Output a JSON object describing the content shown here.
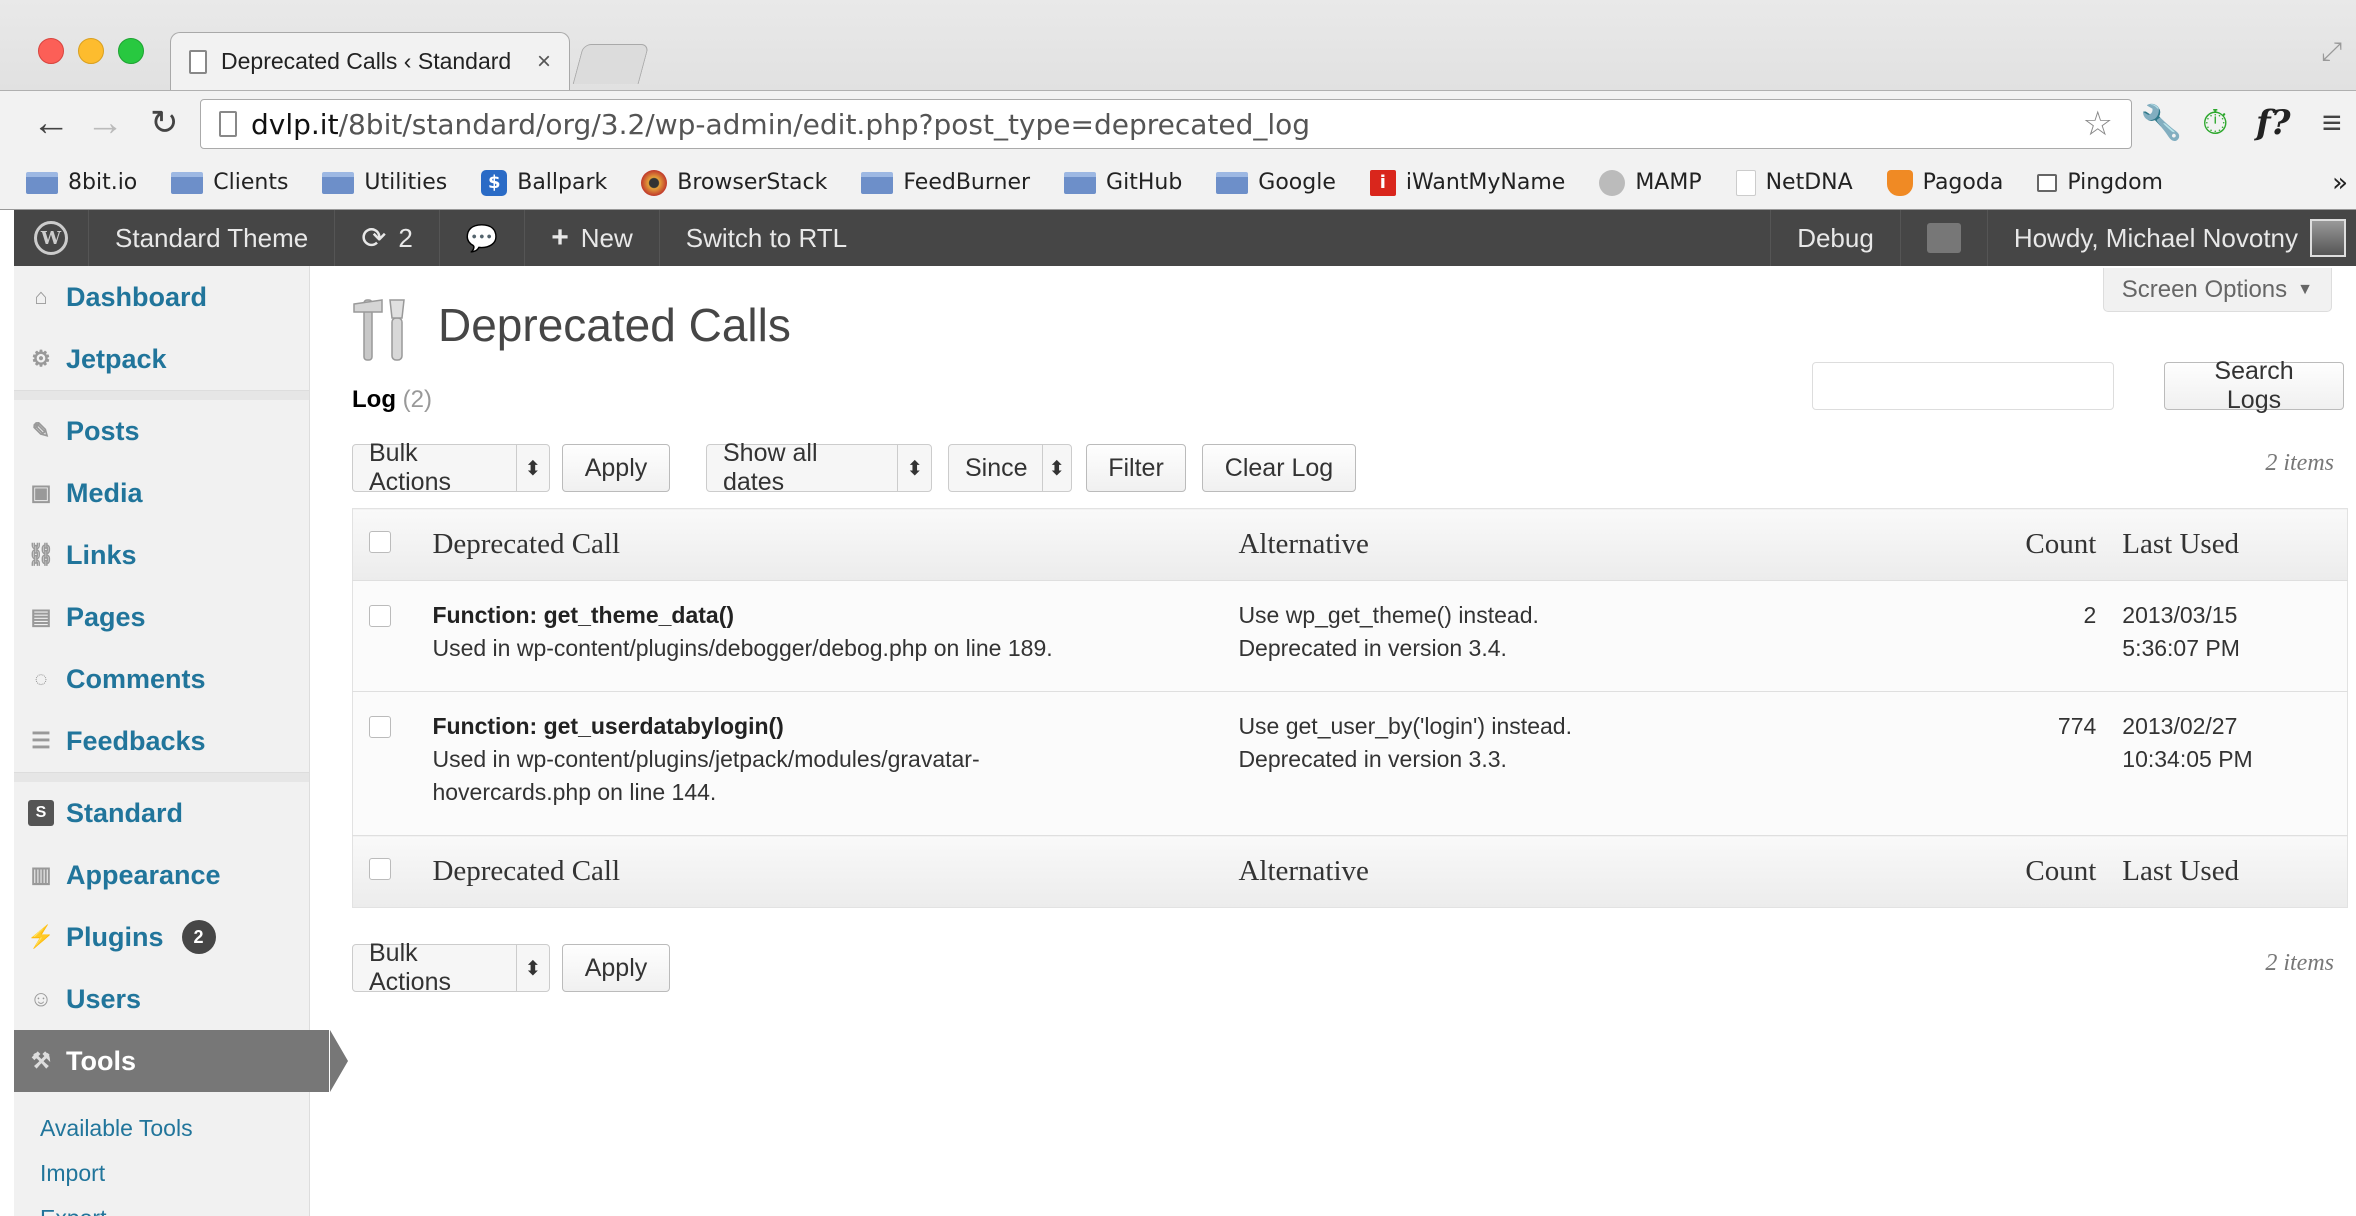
{
  "browser": {
    "tab_title": "Deprecated Calls ‹ Standard",
    "url_host": "dvlp.it",
    "url_path": "/8bit/standard/org/3.2/wp-admin/edit.php?post_type=deprecated_log",
    "bookmarks": [
      {
        "label": "8bit.io",
        "icon": "folder-icon"
      },
      {
        "label": "Clients",
        "icon": "folder-icon"
      },
      {
        "label": "Utilities",
        "icon": "folder-icon"
      },
      {
        "label": "Ballpark",
        "icon": "ballpark-icon"
      },
      {
        "label": "BrowserStack",
        "icon": "browserstack-icon"
      },
      {
        "label": "FeedBurner",
        "icon": "folder-icon"
      },
      {
        "label": "GitHub",
        "icon": "folder-icon"
      },
      {
        "label": "Google",
        "icon": "folder-icon"
      },
      {
        "label": "iWantMyName",
        "icon": "iwantmyname-icon"
      },
      {
        "label": "MAMP",
        "icon": "mamp-icon"
      },
      {
        "label": "NetDNA",
        "icon": "page-icon"
      },
      {
        "label": "Pagoda",
        "icon": "pagoda-icon"
      },
      {
        "label": "Pingdom",
        "icon": "pingdom-icon"
      }
    ],
    "bookmarks_more": "»"
  },
  "adminbar": {
    "site_name": "Standard Theme",
    "updates_count": "2",
    "new_label": "New",
    "rtl_label": "Switch to RTL",
    "debug_label": "Debug",
    "howdy": "Howdy, Michael Novotny"
  },
  "sidebar": {
    "items": [
      {
        "label": "Dashboard",
        "icon": "dashboard-icon"
      },
      {
        "label": "Jetpack",
        "icon": "jetpack-icon"
      },
      {
        "label": "Posts",
        "icon": "pin-icon"
      },
      {
        "label": "Media",
        "icon": "media-icon"
      },
      {
        "label": "Links",
        "icon": "link-icon"
      },
      {
        "label": "Pages",
        "icon": "pages-icon"
      },
      {
        "label": "Comments",
        "icon": "comment-icon"
      },
      {
        "label": "Feedbacks",
        "icon": "feedback-icon"
      },
      {
        "label": "Standard",
        "icon": "standard-icon"
      },
      {
        "label": "Appearance",
        "icon": "appearance-icon"
      },
      {
        "label": "Plugins",
        "icon": "plugin-icon",
        "badge": "2"
      },
      {
        "label": "Users",
        "icon": "users-icon"
      },
      {
        "label": "Tools",
        "icon": "tools-icon"
      }
    ],
    "tools_submenu": [
      "Available Tools",
      "Import",
      "Export"
    ]
  },
  "main": {
    "screen_options": "Screen Options",
    "page_title": "Deprecated Calls",
    "subsub_label": "Log",
    "subsub_count": "(2)",
    "search_button": "Search Logs",
    "bulk_actions": "Bulk Actions",
    "apply": "Apply",
    "dates_select": "Show all dates",
    "since_select": "Since",
    "filter": "Filter",
    "clear_log": "Clear Log",
    "items_count": "2 items",
    "columns": {
      "call": "Deprecated Call",
      "alternative": "Alternative",
      "count": "Count",
      "last_used": "Last Used"
    },
    "rows": [
      {
        "function": "Function: get_theme_data()",
        "used_in": "Used in wp-content/plugins/debogger/debog.php on line 189.",
        "alternative": "Use wp_get_theme() instead.",
        "deprecated_in": "Deprecated in version 3.4.",
        "count": "2",
        "date": "2013/03/15",
        "time": "5:36:07 PM"
      },
      {
        "function": "Function: get_userdatabylogin()",
        "used_in": "Used in wp-content/plugins/jetpack/modules/gravatar-hovercards.php on line 144.",
        "alternative": "Use get_user_by('login') instead.",
        "deprecated_in": "Deprecated in version 3.3.",
        "count": "774",
        "date": "2013/02/27",
        "time": "10:34:05 PM"
      }
    ]
  }
}
